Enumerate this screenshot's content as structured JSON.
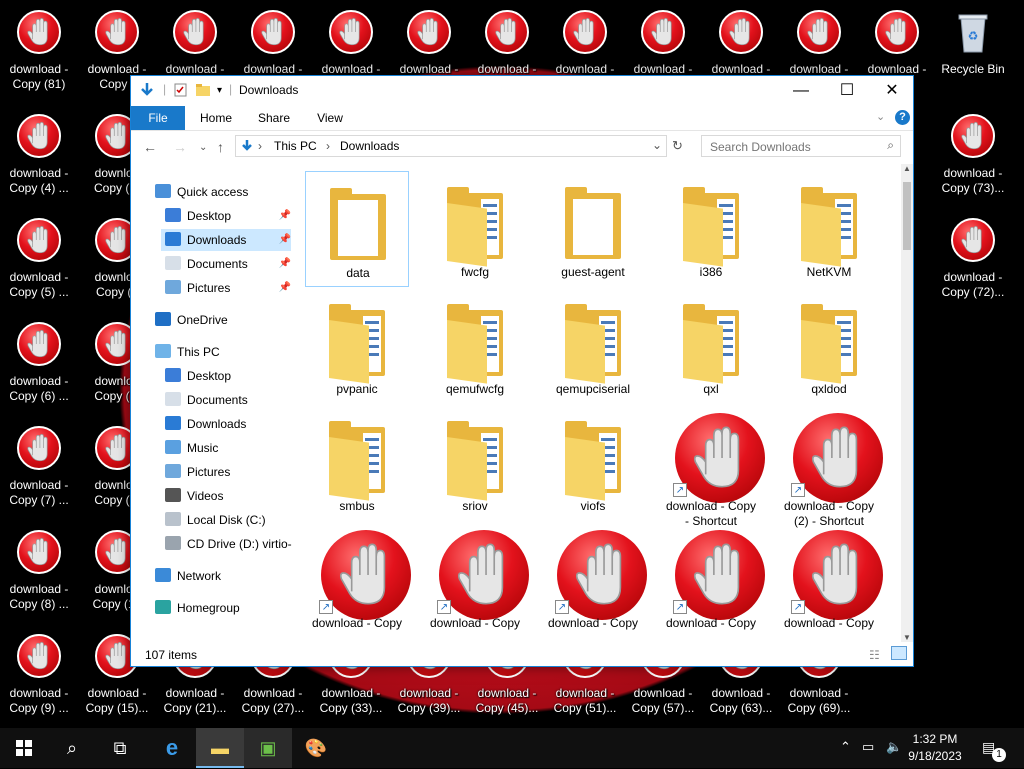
{
  "desktop": {
    "icons_left_column": [
      {
        "label": "download -\nCopy (81)"
      },
      {
        "label": "download -\nCopy (4) ..."
      },
      {
        "label": "download -\nCopy (5) ..."
      },
      {
        "label": "download -\nCopy (6) ..."
      },
      {
        "label": "download -\nCopy (7) ..."
      },
      {
        "label": "download -\nCopy (8) ..."
      },
      {
        "label": "download -\nCopy (9) ..."
      }
    ],
    "icons_second_column": [
      {
        "label": "download -\nCopy ("
      },
      {
        "label": "downloa\nCopy (1("
      },
      {
        "label": "downloa\nCopy (1"
      },
      {
        "label": "downloa\nCopy (1:"
      },
      {
        "label": "downloa\nCopy (1:"
      },
      {
        "label": "downloa\nCopy (14"
      },
      {
        "label": "download -\nCopy (15)..."
      }
    ],
    "icons_top_row": [
      {
        "label": "download -"
      },
      {
        "label": "download -"
      },
      {
        "label": "download -"
      },
      {
        "label": "download -"
      },
      {
        "label": "download -"
      },
      {
        "label": "download -"
      },
      {
        "label": "download -"
      },
      {
        "label": "download -"
      },
      {
        "label": "download -"
      },
      {
        "label": "download -"
      }
    ],
    "icons_bottom_row": [
      {
        "label": "download -\nCopy (21)..."
      },
      {
        "label": "download -\nCopy (27)..."
      },
      {
        "label": "download -\nCopy (33)..."
      },
      {
        "label": "download -\nCopy (39)..."
      },
      {
        "label": "download -\nCopy (45)..."
      },
      {
        "label": "download -\nCopy (51)..."
      },
      {
        "label": "download -\nCopy (57)..."
      },
      {
        "label": "download -\nCopy (63)..."
      },
      {
        "label": "download -\nCopy (69)..."
      }
    ],
    "icons_right_column": [
      {
        "label": "download -\nCopy (73)..."
      },
      {
        "label": "download -\nCopy (72)..."
      }
    ],
    "recycle_bin": {
      "label": "Recycle Bin"
    }
  },
  "window": {
    "title": "Downloads",
    "ribbon_tabs": [
      "File",
      "Home",
      "Share",
      "View"
    ],
    "breadcrumb": [
      "This PC",
      "Downloads"
    ],
    "search_placeholder": "Search Downloads",
    "nav": {
      "quick_access": "Quick access",
      "qa_items": [
        "Desktop",
        "Downloads",
        "Documents",
        "Pictures"
      ],
      "onedrive": "OneDrive",
      "this_pc": "This PC",
      "pc_items": [
        "Desktop",
        "Documents",
        "Downloads",
        "Music",
        "Pictures",
        "Videos",
        "Local Disk (C:)",
        "CD Drive (D:) virtio-"
      ],
      "network": "Network",
      "homegroup": "Homegroup"
    },
    "items": [
      {
        "label": "data",
        "kind": "folder-empty"
      },
      {
        "label": "fwcfg",
        "kind": "folder"
      },
      {
        "label": "guest-agent",
        "kind": "folder-empty"
      },
      {
        "label": "i386",
        "kind": "folder"
      },
      {
        "label": "NetKVM",
        "kind": "folder"
      },
      {
        "label": "pvpanic",
        "kind": "folder"
      },
      {
        "label": "qemufwcfg",
        "kind": "folder"
      },
      {
        "label": "qemupciserial",
        "kind": "folder"
      },
      {
        "label": "qxl",
        "kind": "folder"
      },
      {
        "label": "qxldod",
        "kind": "folder"
      },
      {
        "label": "smbus",
        "kind": "folder"
      },
      {
        "label": "sriov",
        "kind": "folder"
      },
      {
        "label": "viofs",
        "kind": "folder"
      },
      {
        "label": "download - Copy\n- Shortcut",
        "kind": "shortcut"
      },
      {
        "label": "download - Copy\n(2) - Shortcut",
        "kind": "shortcut"
      },
      {
        "label": "download - Copy",
        "kind": "shortcut"
      },
      {
        "label": "download - Copy",
        "kind": "shortcut"
      },
      {
        "label": "download - Copy",
        "kind": "shortcut"
      },
      {
        "label": "download - Copy",
        "kind": "shortcut"
      },
      {
        "label": "download - Copy",
        "kind": "shortcut"
      }
    ],
    "status": "107 items"
  },
  "taskbar": {
    "time": "1:32 PM",
    "date": "9/18/2023",
    "notification_count": "1"
  },
  "colors": {
    "accent": "#1979ca",
    "folder": "#e8b63e",
    "selection": "#cce8ff",
    "taskbar": "#101010"
  }
}
